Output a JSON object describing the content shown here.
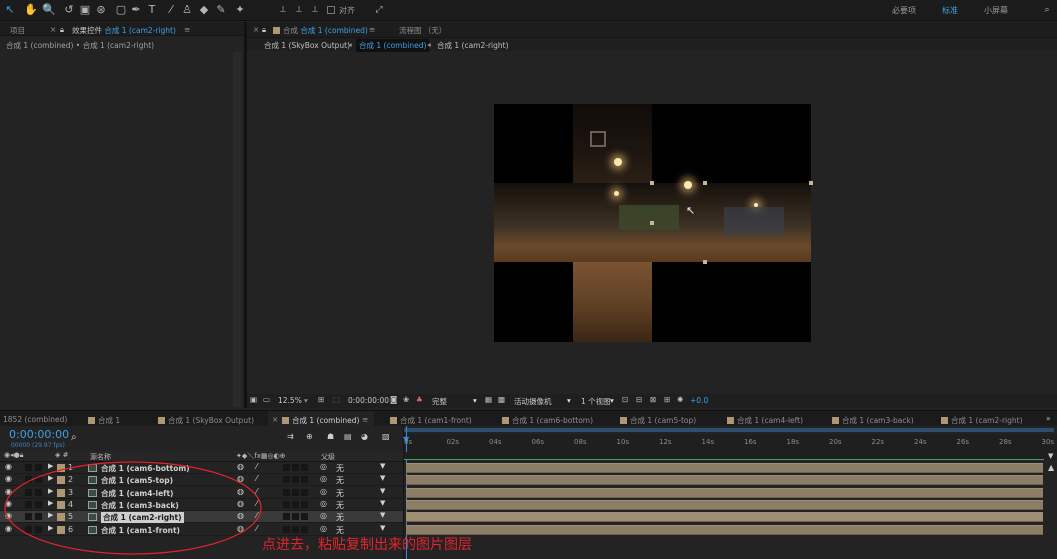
{
  "toolbar": {
    "align_label": "对齐",
    "workspaces": [
      "必要项",
      "标准",
      "小屏幕"
    ],
    "active_workspace": "标准",
    "tools": [
      "selection-tool-icon",
      "hand-tool-icon",
      "zoom-tool-icon",
      "rotate-tool-icon",
      "camera-orbit-icon",
      "pan-behind-icon",
      "rectangle-tool-icon",
      "pen-tool-icon",
      "type-tool-icon",
      "brush-tool-icon",
      "clone-stamp-icon",
      "eraser-tool-icon",
      "roto-brush-icon",
      "puppet-pin-icon"
    ]
  },
  "left_panel": {
    "tab_project": "项目",
    "tab_effects_prefix": "效果控件",
    "tab_effects_comp": "合成 1 (cam2-right)",
    "breadcrumb": "合成 1 (combined) • 合成 1 (cam2-right)"
  },
  "viewer": {
    "tab_prefix": "合成",
    "tab_comp": "合成 1 (combined)",
    "tab_flowchart": "流程图 （无）",
    "nav": [
      "合成 1 (SkyBox Output)",
      "合成 1 (combined)",
      "合成 1 (cam2-right)"
    ],
    "zoom": "12.5%",
    "timecode": "0:00:00:00",
    "resolution": "完整",
    "camera": "活动摄像机",
    "views": "1 个视图",
    "exposure": "+0.0"
  },
  "timeline_tabs": [
    "1852 (combined)",
    "合成 1",
    "合成 1 (SkyBox Output)",
    "合成 1 (combined)",
    "合成 1 (cam1-front)",
    "合成 1 (cam6-bottom)",
    "合成 1 (cam5-top)",
    "合成 1 (cam4-left)",
    "合成 1 (cam3-back)",
    "合成 1 (cam2-right)"
  ],
  "timeline": {
    "timecode": "0:00:00:00",
    "fps": "00000 (29.97 fps)",
    "search_placeholder": "",
    "col_source": "源名称",
    "col_parent": "父级",
    "ruler": [
      "0s",
      "02s",
      "04s",
      "06s",
      "08s",
      "10s",
      "12s",
      "14s",
      "16s",
      "18s",
      "20s",
      "22s",
      "24s",
      "26s",
      "28s",
      "30s"
    ],
    "layers": [
      {
        "num": "1",
        "name": "合成 1 (cam6-bottom)",
        "parent": "无",
        "selected": false
      },
      {
        "num": "2",
        "name": "合成 1 (cam5-top)",
        "parent": "无",
        "selected": false
      },
      {
        "num": "3",
        "name": "合成 1 (cam4-left)",
        "parent": "无",
        "selected": false
      },
      {
        "num": "4",
        "name": "合成 1 (cam3-back)",
        "parent": "无",
        "selected": false
      },
      {
        "num": "5",
        "name": "合成 1 (cam2-right)",
        "parent": "无",
        "selected": true
      },
      {
        "num": "6",
        "name": "合成 1 (cam1-front)",
        "parent": "无",
        "selected": false
      }
    ]
  },
  "annotation": "点进去，粘贴复制出来的图片图层",
  "colors": {
    "accent": "#3ea0e6",
    "label": "#b09774",
    "annotation": "#e0242c"
  }
}
